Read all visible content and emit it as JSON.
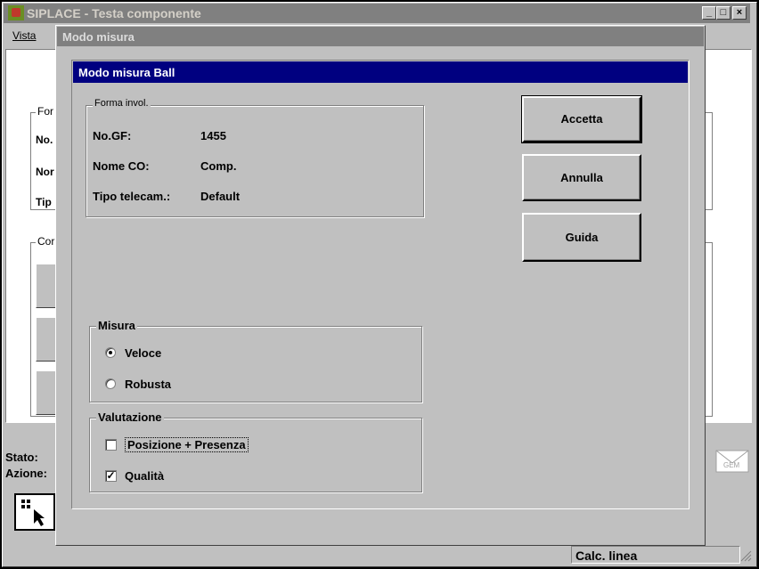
{
  "main_window": {
    "title": "SIPLACE - Testa componente",
    "menu": [
      "Vista"
    ],
    "controls": {
      "minimize": "_",
      "maximize": "□",
      "close": "×"
    }
  },
  "background": {
    "group_top_label": "For",
    "labels": [
      "No.",
      "Nor",
      "Tip"
    ],
    "group_mid_label": "Cor",
    "stato_label": "Stato:",
    "azione_label": "Azione:",
    "gem_label": "GEM"
  },
  "dialog_outer": {
    "title": "Modo misura"
  },
  "dialog": {
    "title": "Modo misura Ball",
    "package_group": {
      "label": "Forma invol.",
      "rows": [
        {
          "key": "No.GF:",
          "value": "1455"
        },
        {
          "key": "Nome CO:",
          "value": "Comp."
        },
        {
          "key": "Tipo telecam.:",
          "value": "Default"
        }
      ]
    },
    "buttons": {
      "accept": "Accetta",
      "cancel": "Annulla",
      "help": "Guida"
    },
    "misura": {
      "label": "Misura",
      "options": [
        {
          "label": "Veloce",
          "selected": true
        },
        {
          "label": "Robusta",
          "selected": false
        }
      ]
    },
    "valutazione": {
      "label": "Valutazione",
      "options": [
        {
          "label": "Posizione + Presenza",
          "checked": false
        },
        {
          "label": "Qualità",
          "checked": true
        }
      ]
    }
  },
  "status_bar": {
    "calc": "Calc. linea"
  },
  "colors": {
    "active_title": "#000080",
    "inactive_title": "#808080",
    "face": "#c0c0c0"
  }
}
